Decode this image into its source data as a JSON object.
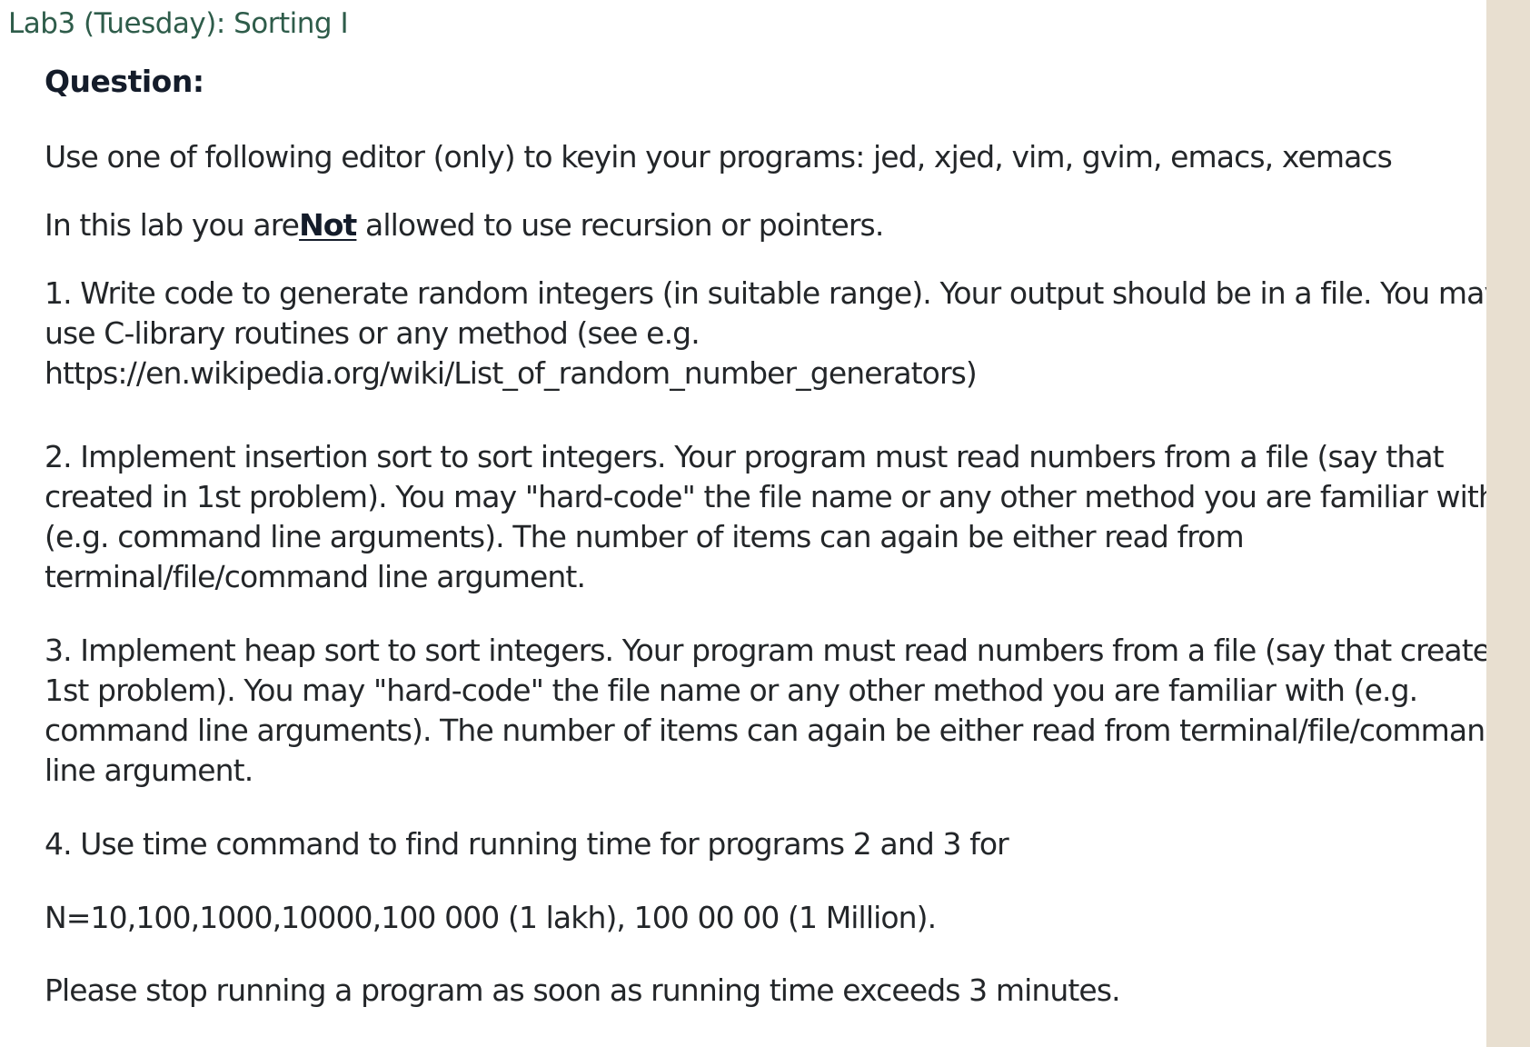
{
  "title": "Lab3 (Tuesday): Sorting I",
  "heading": "Question:",
  "editor_line": "Use one of following editor (only) to keyin your programs: jed,  xjed, vim, gvim, emacs, xemacs",
  "restriction": {
    "before": "In this lab you are",
    "emphasis": "Not",
    "after": "allowed to use recursion or pointers."
  },
  "items": [
    {
      "lines": [
        "1. Write code to generate random integers (in suitable range). Your output should be in a file. You may",
        "use C-library routines or any method (see e.g.",
        "https://en.wikipedia.org/wiki/List_of_random_number_generators)"
      ]
    },
    {
      "lines": [
        "2. Implement insertion sort to sort integers. Your program must read numbers from a file (say that",
        "created in 1st problem). You may \"hard-code\" the file name or any other method you are familiar with",
        "(e.g. command line arguments). The number of items can again be either read from",
        "terminal/file/command line argument."
      ]
    },
    {
      "lines": [
        "3. Implement heap sort to sort integers. Your program must read numbers from a file (say that created in",
        "1st problem). You may \"hard-code\" the file name or any other method you are familiar with (e.g.",
        "command line arguments). The number of items can again be either read from terminal/file/command",
        "line argument."
      ]
    },
    {
      "lines": [
        "4.  Use time command to find running time for programs 2 and 3 for"
      ]
    }
  ],
  "sizes_line": "N=10,100,1000,10000,100 000 (1 lakh), 100 00 00 (1 Million).",
  "stop_line": "Please stop running a program as soon as running time exceeds 3 minutes.",
  "colors": {
    "title": "#2e5c4a",
    "heading": "#141c2a",
    "body_text": "#232629",
    "right_strip": "#e8dfd0"
  }
}
